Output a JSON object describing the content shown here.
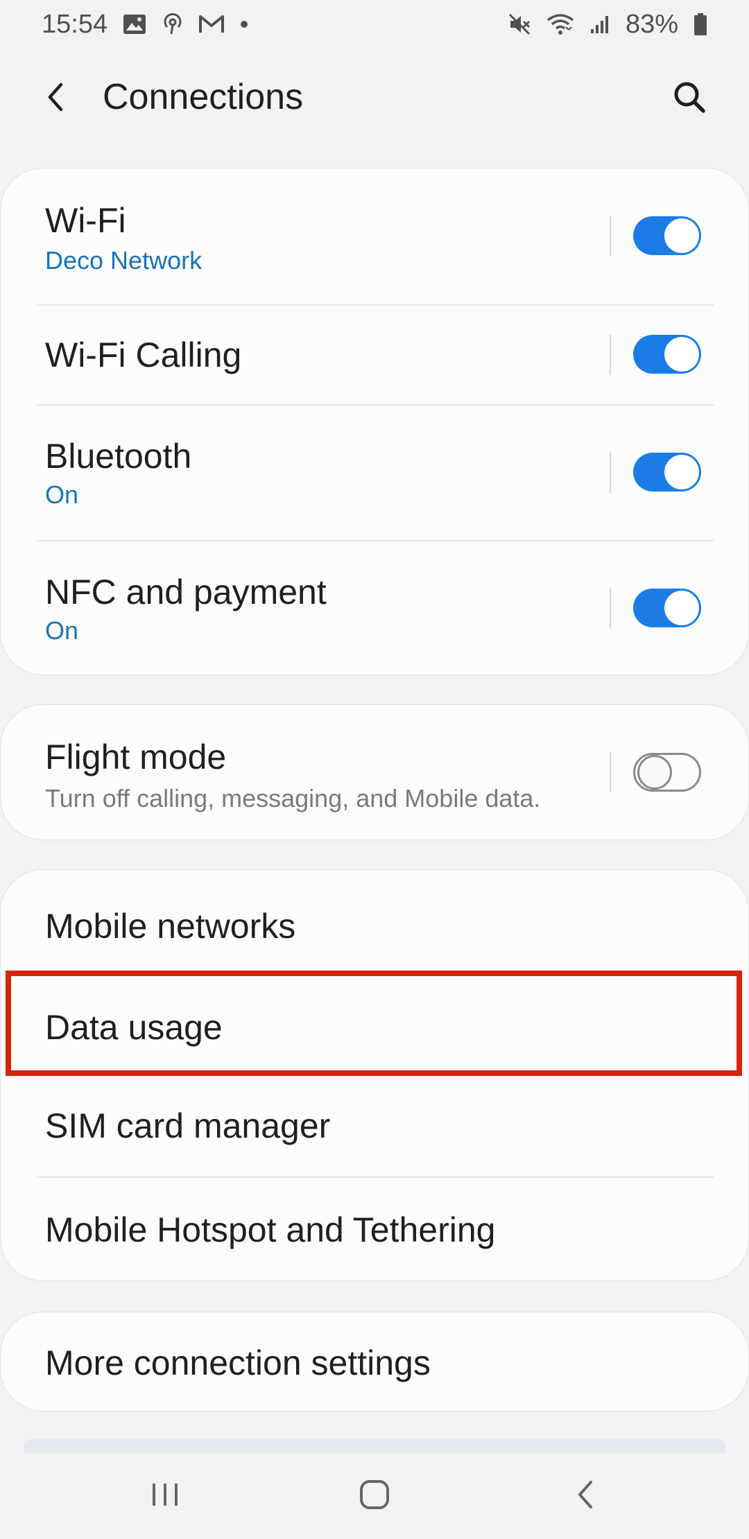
{
  "status_bar": {
    "time": "15:54",
    "battery": "83%",
    "left_icons": [
      "gallery-icon",
      "podcast-icon",
      "gmail-icon",
      "dot-icon"
    ],
    "right_icons": [
      "mute-icon",
      "wifi-icon",
      "signal-icon",
      "battery-icon"
    ]
  },
  "header": {
    "title": "Connections",
    "back_icon": "back-arrow-icon",
    "search_icon": "search-icon"
  },
  "connectivity_group": [
    {
      "title": "Wi-Fi",
      "subtitle": "Deco Network",
      "toggle": true
    },
    {
      "title": "Wi-Fi Calling",
      "subtitle": "",
      "toggle": true
    },
    {
      "title": "Bluetooth",
      "subtitle": "On",
      "toggle": true
    },
    {
      "title": "NFC and payment",
      "subtitle": "On",
      "toggle": true
    }
  ],
  "flight_group": {
    "title": "Flight mode",
    "subtitle": "Turn off calling, messaging, and Mobile data.",
    "toggle": false
  },
  "network_group": [
    {
      "title": "Mobile networks"
    },
    {
      "title": "Data usage"
    },
    {
      "title": "SIM card manager"
    },
    {
      "title": "Mobile Hotspot and Tethering"
    }
  ],
  "more_group": {
    "title": "More connection settings"
  },
  "nav_bar": {
    "icons": [
      "recent-apps-icon",
      "home-icon",
      "back-icon"
    ]
  },
  "colors": {
    "accent": "#1b7ce6",
    "subtitle_blue": "#1a73b8",
    "highlight": "#d7220c",
    "background": "#f2f2f2"
  }
}
